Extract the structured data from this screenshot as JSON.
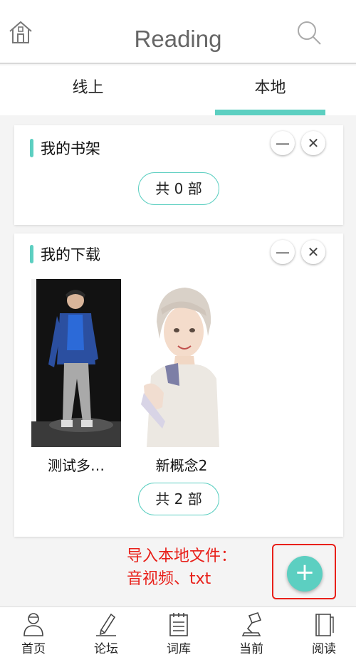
{
  "header": {
    "title": "Reading",
    "home_icon": "home-icon",
    "search_icon": "search-icon"
  },
  "tabs": [
    {
      "label": "线上",
      "active": false
    },
    {
      "label": "本地",
      "active": true
    }
  ],
  "accent_color": "#5ccfc1",
  "shelf": {
    "title": "我的书架",
    "count_label": "共 0 部"
  },
  "download": {
    "title": "我的下载",
    "books": [
      {
        "name": "测试多…"
      },
      {
        "name": "新概念2"
      }
    ],
    "count_label": "共 2 部"
  },
  "annotation": {
    "line1": "导入本地文件：",
    "line2": "音视频、txt",
    "color": "#e8201a"
  },
  "fab": {
    "label": "+"
  },
  "bottom_nav": [
    {
      "label": "首页",
      "icon": "person-icon"
    },
    {
      "label": "论坛",
      "icon": "pen-icon"
    },
    {
      "label": "词库",
      "icon": "notebook-icon"
    },
    {
      "label": "当前",
      "icon": "lamp-icon"
    },
    {
      "label": "阅读",
      "icon": "book-icon"
    }
  ]
}
